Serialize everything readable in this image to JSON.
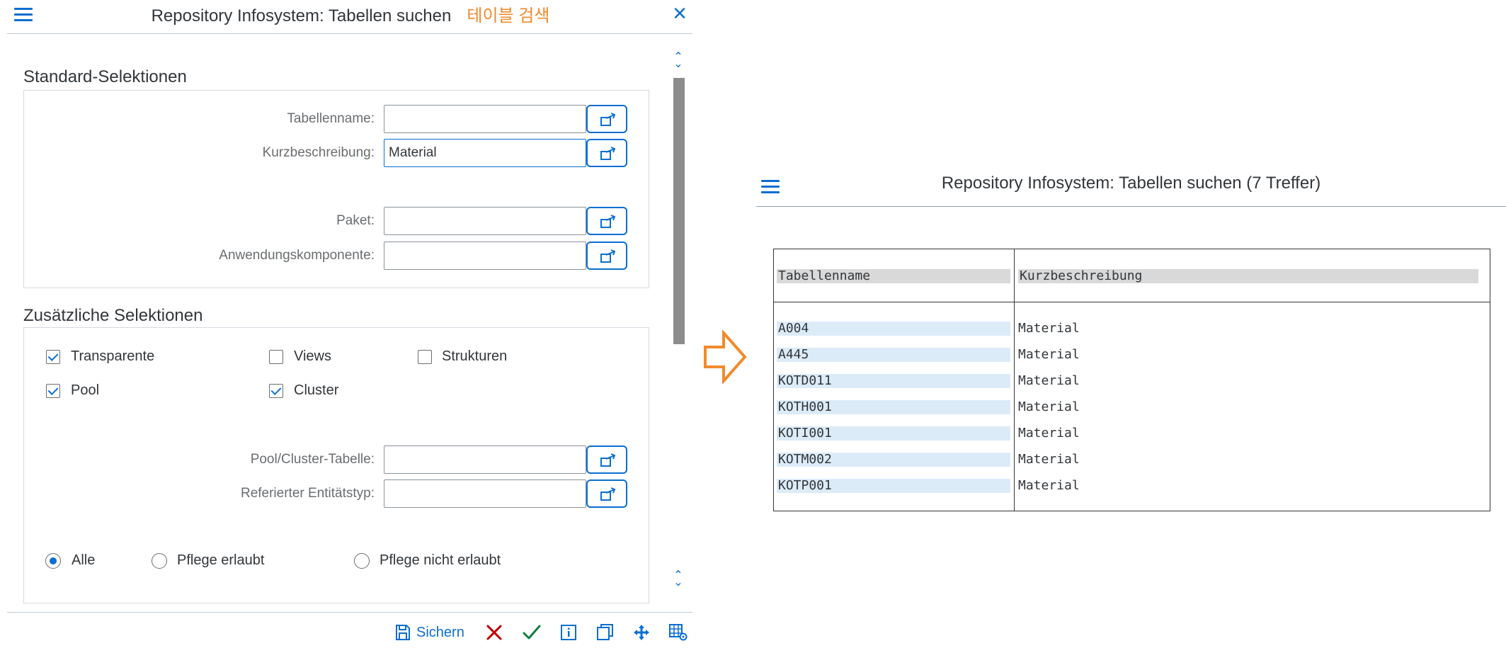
{
  "dialog": {
    "title": "Repository Infosystem: Tabellen suchen",
    "title_ko": "테이블 검색",
    "menu_icon": "hamburger-menu-icon",
    "close_icon": "close-x-icon"
  },
  "standard": {
    "title": "Standard-Selektionen",
    "fields": [
      {
        "label": "Tabellenname:",
        "value": ""
      },
      {
        "label": "Kurzbeschreibung:",
        "value": "Material"
      },
      {
        "label": "Paket:",
        "value": ""
      },
      {
        "label": "Anwendungskomponente:",
        "value": ""
      }
    ]
  },
  "additional": {
    "title": "Zusätzliche Selektionen",
    "checkboxes": [
      {
        "label": "Transparente",
        "checked": true
      },
      {
        "label": "Views",
        "checked": false
      },
      {
        "label": "Strukturen",
        "checked": false
      },
      {
        "label": "Pool",
        "checked": true
      },
      {
        "label": "Cluster",
        "checked": true
      }
    ],
    "fields": [
      {
        "label": "Pool/Cluster-Tabelle:",
        "value": ""
      },
      {
        "label": "Referierter Entitätstyp:",
        "value": ""
      }
    ],
    "radios": [
      {
        "label": "Alle",
        "selected": true
      },
      {
        "label": "Pflege erlaubt",
        "selected": false
      },
      {
        "label": "Pflege nicht erlaubt",
        "selected": false
      }
    ]
  },
  "toolbar": {
    "save_label": "Sichern",
    "icons": [
      "save-icon",
      "cancel-icon",
      "execute-check-icon",
      "info-icon",
      "copy-icon",
      "move-icon",
      "settings-table-icon"
    ]
  },
  "colors": {
    "accent": "#0a6ed1",
    "korean_title": "#f28a2b",
    "cancel": "#bb0000",
    "check": "#107e3e",
    "arrow": "#f28a2b",
    "row_highlight": "#dcebf8",
    "header_bg": "#d9d9d9"
  },
  "result": {
    "title": "Repository Infosystem: Tabellen suchen (7 Treffer)",
    "columns": [
      "Tabellenname",
      "Kurzbeschreibung"
    ],
    "rows": [
      [
        "A004",
        "Material"
      ],
      [
        "A445",
        "Material"
      ],
      [
        "KOTD011",
        "Material"
      ],
      [
        "KOTH001",
        "Material"
      ],
      [
        "KOTI001",
        "Material"
      ],
      [
        "KOTM002",
        "Material"
      ],
      [
        "KOTP001",
        "Material"
      ]
    ]
  }
}
